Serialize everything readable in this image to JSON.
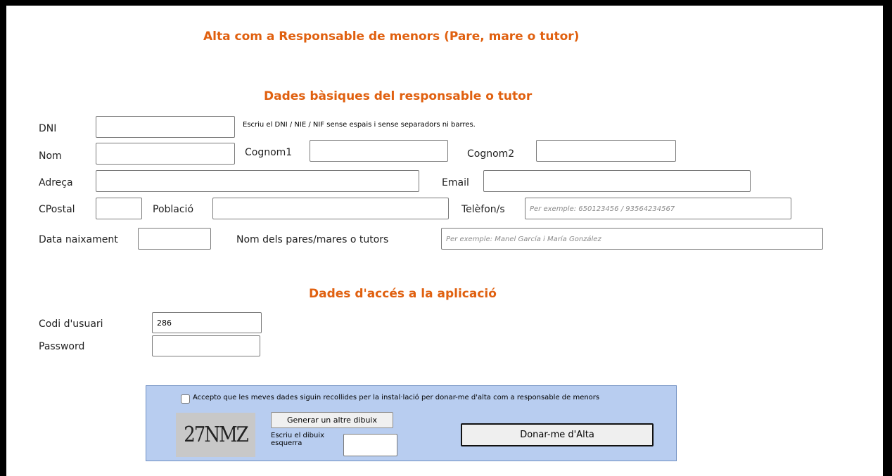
{
  "page_title": "Alta com a Responsable de menors (Pare, mare o tutor)",
  "basic": {
    "heading": "Dades bàsiques del responsable o tutor",
    "dni_label": "DNI",
    "dni_note": "Escriu el DNI / NIE / NIF sense espais i sense separadors ni barres.",
    "nom_label": "Nom",
    "cognom1_label": "Cognom1",
    "cognom2_label": "Cognom2",
    "adreca_label": "Adreça",
    "email_label": "Email",
    "cpostal_label": "CPostal",
    "poblacio_label": "Població",
    "telefon_label": "Telèfon/s",
    "telefon_placeholder": "Per exemple: 650123456 / 93564234567",
    "naixement_label": "Data naixament",
    "pares_label": "Nom dels pares/mares o tutors",
    "pares_placeholder": "Per exemple: Manel García i María González"
  },
  "access": {
    "heading": "Dades d'accés a la aplicació",
    "user_label": "Codi d'usuari",
    "user_value": "286",
    "password_label": "Password"
  },
  "consent": {
    "checkbox_label": "Accepto que les meves dades siguin recollides per la instal·lació per donar-me d'alta com a responsable de menors",
    "captcha_text": "27NMZ",
    "regen_button": "Generar un altre dibuix",
    "captcha_label": "Escriu el dibuix esquerra",
    "submit_button": "Donar-me d'Alta"
  }
}
